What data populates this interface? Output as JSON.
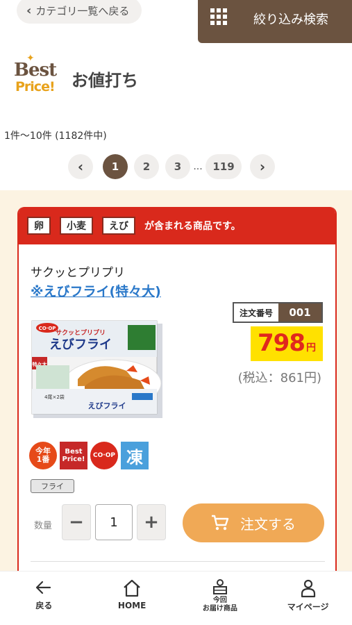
{
  "header": {
    "back_label": "カテゴリ一覧へ戻る",
    "filter_label": "絞り込み検索"
  },
  "logo": {
    "line1": "Best",
    "line2": "Price!"
  },
  "page": {
    "title": "お値打ち",
    "count_text": "1件〜10件 (1182件中)"
  },
  "pagination": {
    "pages": [
      "1",
      "2",
      "3"
    ],
    "ellipsis": "...",
    "last": "119",
    "current": "1"
  },
  "product": {
    "allergens": [
      "卵",
      "小麦",
      "えび"
    ],
    "allergen_suffix": "が含まれる商品です。",
    "catchphrase": "サクッとプリプリ",
    "name": "※えびフライ(特々大)",
    "order_no_label": "注文番号",
    "order_no": "001",
    "price": "798",
    "price_unit": "円",
    "tax_included": "(税込：861円)",
    "badges": [
      {
        "name": "今年1番",
        "label": "今年\n1番"
      },
      {
        "name": "best-price",
        "label": "Best\nPrice!"
      },
      {
        "name": "co-op",
        "label": "CO·OP"
      },
      {
        "name": "frozen",
        "label": "凍"
      }
    ],
    "category_tag": "フライ",
    "qty_label": "数量",
    "qty_value": "1",
    "order_button": "注文する"
  },
  "package": {
    "brand": "CO·OP",
    "catch": "サクッとプリプリ",
    "name": "えびフライ",
    "size": "特々大",
    "count": "4尾×2袋",
    "side_name": "えびフライ"
  },
  "tabbar": [
    {
      "name": "back",
      "label": "戻る"
    },
    {
      "name": "home",
      "label": "HOME"
    },
    {
      "name": "delivery",
      "label": "今回\nお届け商品"
    },
    {
      "name": "mypage",
      "label": "マイページ"
    }
  ],
  "colors": {
    "brown": "#6b5340",
    "red": "#d9291c",
    "price_yellow": "#ffe100",
    "order_orange": "#f0a956",
    "link_blue": "#2a78c9",
    "cream": "#fcf3e2"
  }
}
